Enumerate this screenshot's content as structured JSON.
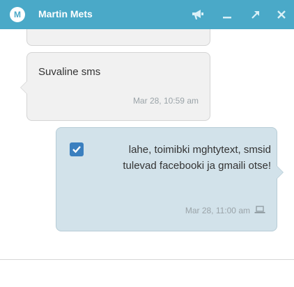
{
  "header": {
    "avatar_letter": "M",
    "title": "Martin Mets",
    "icons": [
      "megaphone-icon",
      "minimize-icon",
      "popout-icon",
      "close-icon"
    ],
    "background": "#4aa9c8"
  },
  "messages": [
    {
      "direction": "incoming",
      "text": "",
      "time": ""
    },
    {
      "direction": "incoming",
      "text": "Suvaline sms",
      "time": "Mar 28, 10:59 am"
    },
    {
      "direction": "outgoing",
      "text": "lahe, toimibki mghtytext, smsid tulevad facebooki ja gmaili otse!",
      "time": "Mar 28, 11:00 am",
      "checked": true,
      "device_icon": "laptop-icon"
    }
  ],
  "composer": {
    "value": "",
    "placeholder": ""
  },
  "colors": {
    "incoming_bubble": "#f1f1f1",
    "outgoing_bubble": "#d2e2ea",
    "checkbox": "#3a7fbf"
  }
}
